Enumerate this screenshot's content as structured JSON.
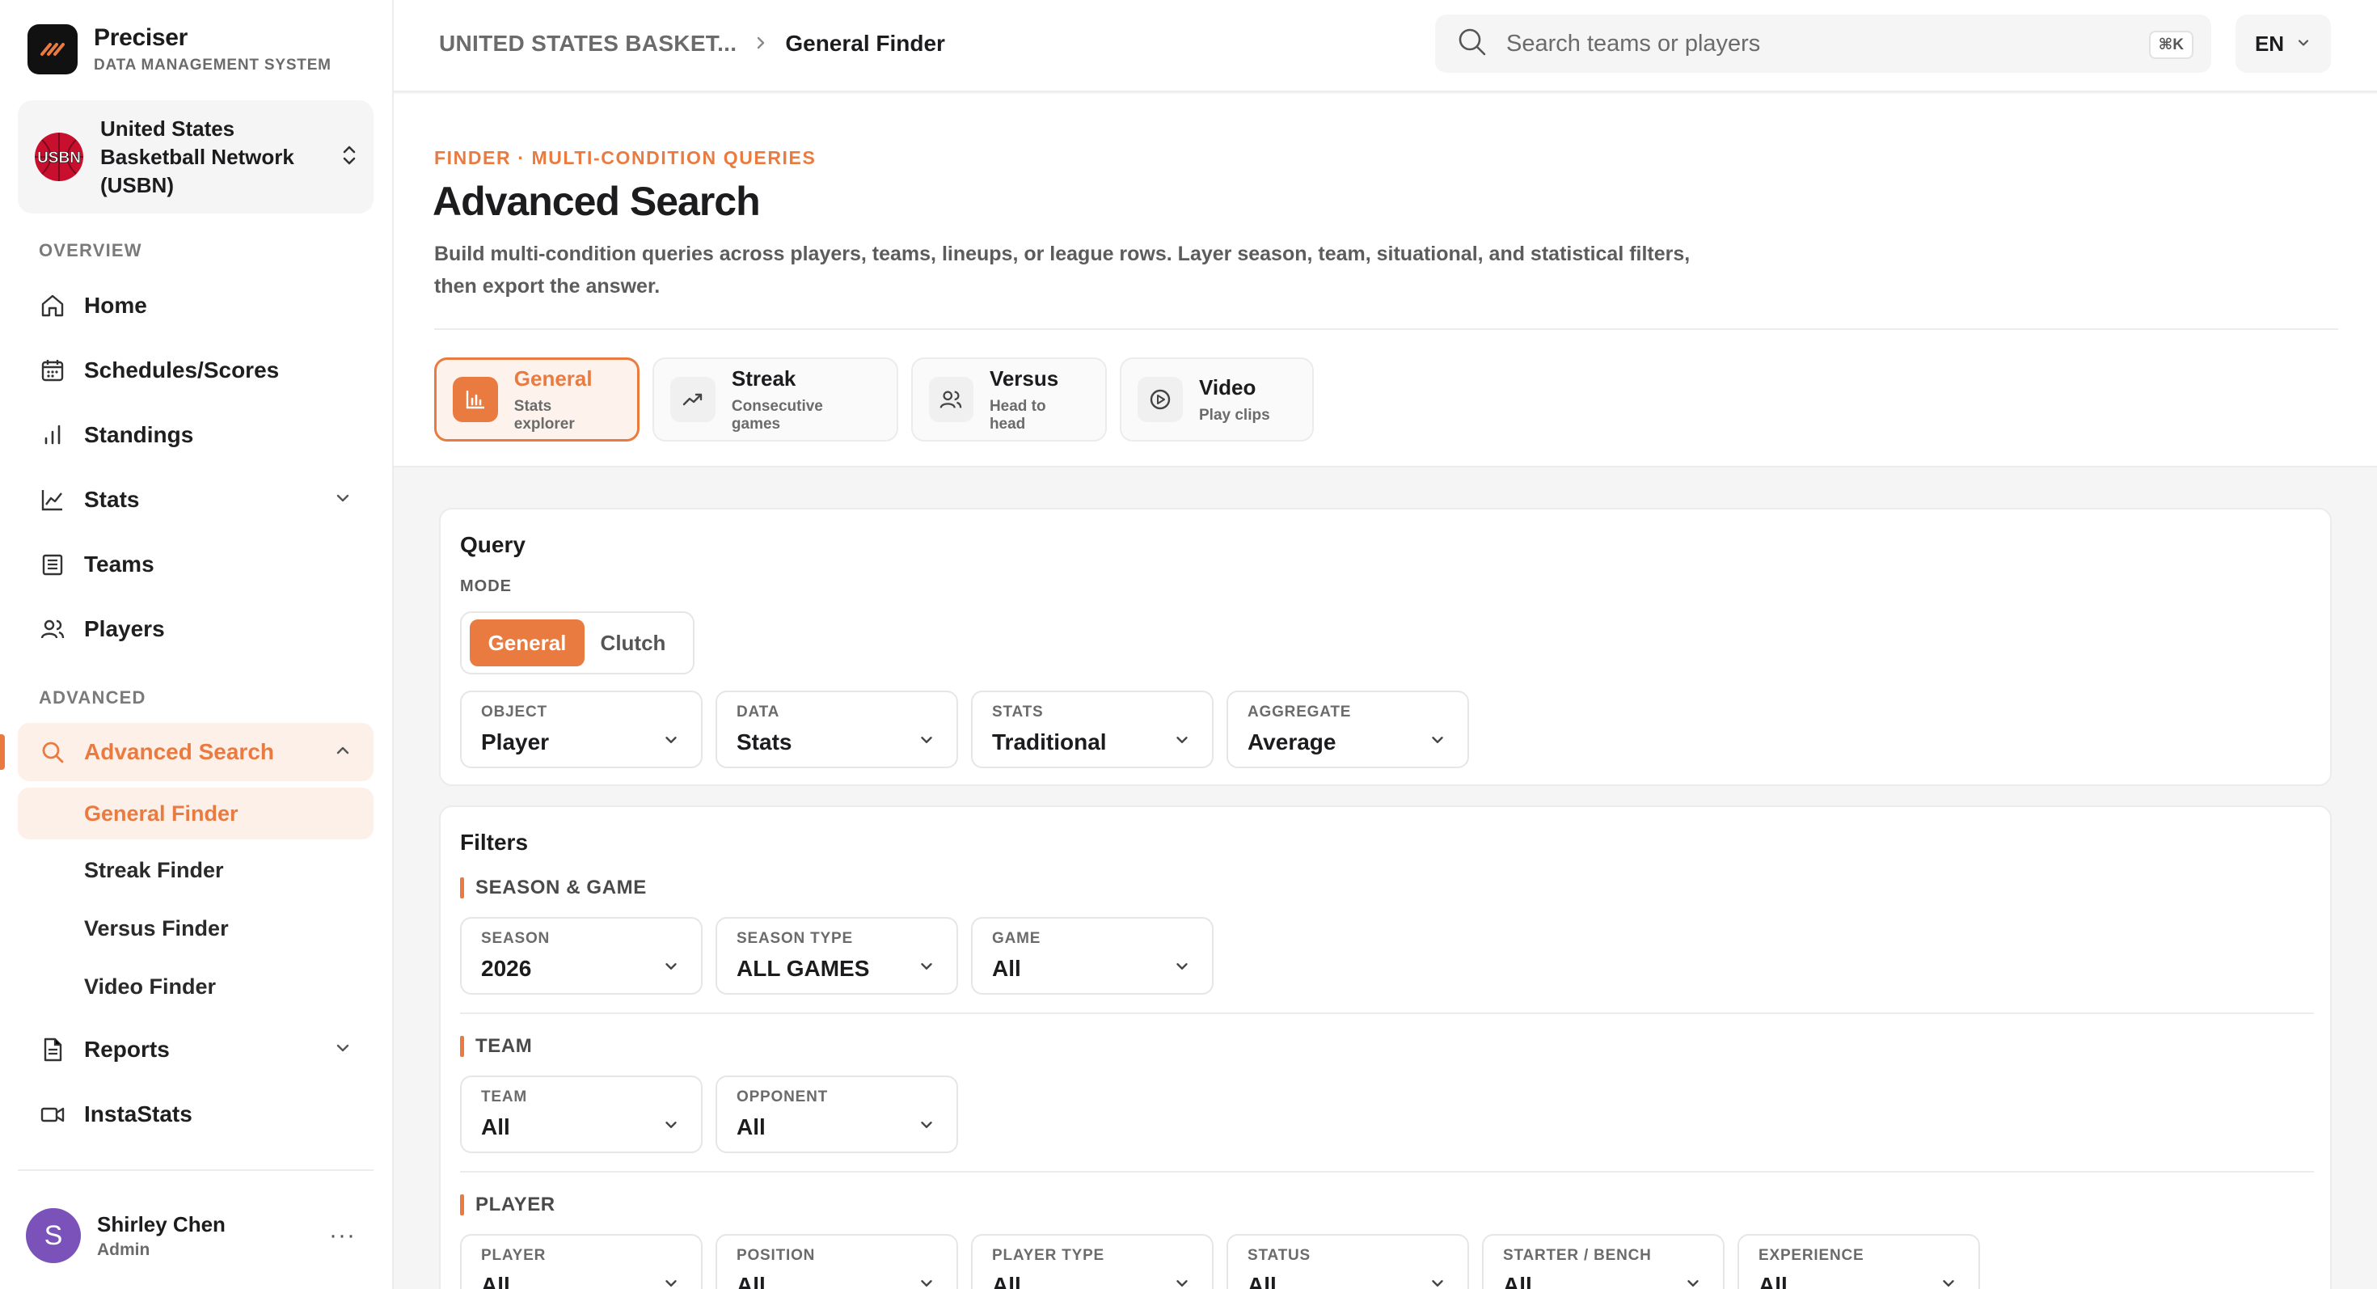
{
  "brand": {
    "name": "Preciser",
    "subtitle": "DATA MANAGEMENT SYSTEM"
  },
  "org": {
    "name": "United States Basketball Network (USBN)",
    "logo_text": "USBN"
  },
  "sidebar": {
    "overview_label": "OVERVIEW",
    "advanced_label": "ADVANCED",
    "items": {
      "home": "Home",
      "schedules": "Schedules/Scores",
      "standings": "Standings",
      "stats": "Stats",
      "teams": "Teams",
      "players": "Players",
      "advanced_search": "Advanced Search",
      "reports": "Reports",
      "instastats": "InstaStats"
    },
    "sub_items": {
      "general": "General Finder",
      "streak": "Streak Finder",
      "versus": "Versus Finder",
      "video": "Video Finder"
    }
  },
  "user": {
    "initial": "S",
    "name": "Shirley Chen",
    "role": "Admin",
    "more": "···"
  },
  "header": {
    "breadcrumb": [
      "UNITED STATES BASKET...",
      "General Finder"
    ],
    "search_placeholder": "Search teams or players",
    "shortcut": "⌘K",
    "language": "EN"
  },
  "page": {
    "eyebrow": "FINDER · MULTI-CONDITION QUERIES",
    "title": "Advanced Search",
    "description": "Build multi-condition queries across players, teams, lineups, or league rows. Layer season, team, situational, and statistical filters, then export the answer."
  },
  "mode_tabs": [
    {
      "title": "General",
      "subtitle": "Stats explorer",
      "icon": "bar-chart-icon",
      "active": true
    },
    {
      "title": "Streak",
      "subtitle": "Consecutive games",
      "icon": "trending-up-icon",
      "active": false
    },
    {
      "title": "Versus",
      "subtitle": "Head to head",
      "icon": "users-icon",
      "active": false
    },
    {
      "title": "Video",
      "subtitle": "Play clips",
      "icon": "play-circle-icon",
      "active": false
    }
  ],
  "query": {
    "title": "Query",
    "mode_label": "MODE",
    "modes": [
      "General",
      "Clutch"
    ],
    "selected_mode": "General",
    "selects": [
      {
        "label": "OBJECT",
        "value": "Player"
      },
      {
        "label": "DATA",
        "value": "Stats"
      },
      {
        "label": "STATS",
        "value": "Traditional"
      },
      {
        "label": "AGGREGATE",
        "value": "Average"
      }
    ]
  },
  "filters": {
    "title": "Filters",
    "groups": [
      {
        "label": "SEASON & GAME",
        "selects": [
          {
            "label": "SEASON",
            "value": "2026"
          },
          {
            "label": "SEASON TYPE",
            "value": "ALL GAMES"
          },
          {
            "label": "GAME",
            "value": "All"
          }
        ]
      },
      {
        "label": "TEAM",
        "selects": [
          {
            "label": "TEAM",
            "value": "All"
          },
          {
            "label": "OPPONENT",
            "value": "All"
          }
        ]
      },
      {
        "label": "PLAYER",
        "selects": [
          {
            "label": "PLAYER",
            "value": "All"
          },
          {
            "label": "POSITION",
            "value": "All"
          },
          {
            "label": "PLAYER TYPE",
            "value": "All"
          },
          {
            "label": "STATUS",
            "value": "All"
          },
          {
            "label": "STARTER / BENCH",
            "value": "All"
          },
          {
            "label": "EXPERIENCE",
            "value": "All"
          }
        ]
      }
    ]
  },
  "colors": {
    "accent": "#ea7b40",
    "accent_soft": "#fdf0e8",
    "text": "#1c1c1e",
    "muted": "#6b6b6b",
    "avatar": "#7b52b9"
  }
}
